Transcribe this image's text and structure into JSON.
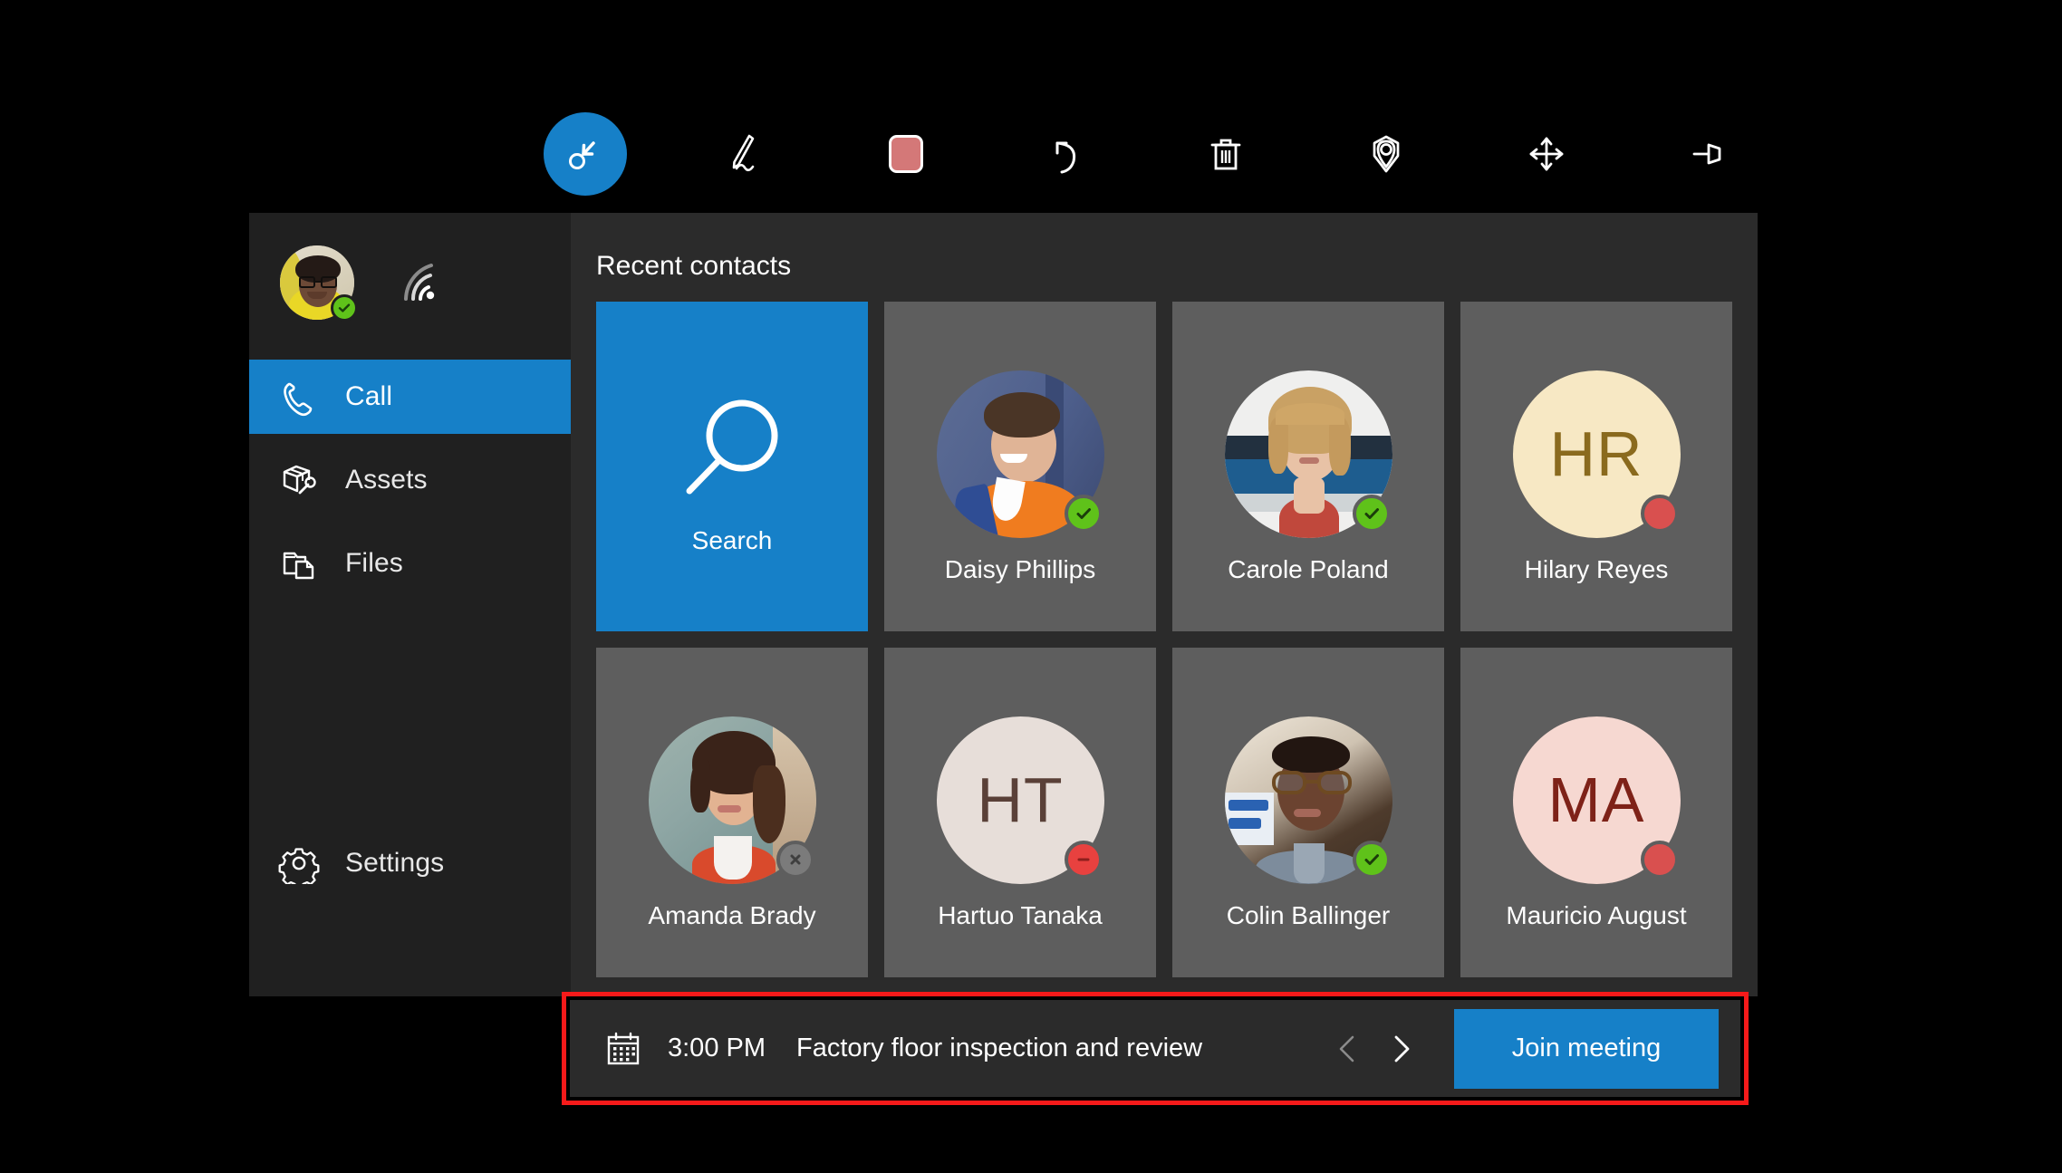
{
  "toolbar": {
    "tools": [
      {
        "name": "select-tool",
        "icon": "select-arrow-icon",
        "active": true
      },
      {
        "name": "ink-pen-tool",
        "icon": "pen-icon",
        "active": false
      },
      {
        "name": "color-swatch",
        "icon": "color-swatch-icon",
        "active": false,
        "color": "#d47878"
      },
      {
        "name": "undo-tool",
        "icon": "undo-arrow-icon",
        "active": false
      },
      {
        "name": "delete-tool",
        "icon": "trash-icon",
        "active": false
      },
      {
        "name": "place-hologram-tool",
        "icon": "location-pin-icon",
        "active": false
      },
      {
        "name": "move-tool",
        "icon": "move-arrows-icon",
        "active": false
      },
      {
        "name": "pin-tool",
        "icon": "pushpin-icon",
        "active": false
      }
    ]
  },
  "sidebar": {
    "profile": {
      "status": "available",
      "status_color": "#5fc21a",
      "signal_icon": "wifi-signal-icon"
    },
    "items": [
      {
        "label": "Call",
        "icon": "phone-icon",
        "selected": true
      },
      {
        "label": "Assets",
        "icon": "box-wrench-icon",
        "selected": false
      },
      {
        "label": "Files",
        "icon": "folder-document-icon",
        "selected": false
      },
      {
        "label": "Settings",
        "icon": "gear-icon",
        "selected": false
      }
    ]
  },
  "main": {
    "section_title": "Recent contacts",
    "search_tile": {
      "label": "Search",
      "icon": "magnifier-icon"
    },
    "contacts": [
      {
        "name": "Daisy Phillips",
        "type": "photo",
        "status": "available",
        "status_icon": "check-icon"
      },
      {
        "name": "Carole Poland",
        "type": "photo",
        "status": "available",
        "status_icon": "check-icon"
      },
      {
        "name": "Hilary Reyes",
        "type": "initials",
        "initials": "HR",
        "bg": "#f7e8c4",
        "fg": "#8a6a1e",
        "status": "busy",
        "status_icon": "none"
      },
      {
        "name": "Amanda Brady",
        "type": "photo",
        "status": "offline",
        "status_icon": "x-icon"
      },
      {
        "name": "Hartuo Tanaka",
        "type": "initials",
        "initials": "HT",
        "bg": "#e7ded9",
        "fg": "#5a4038",
        "status": "dnd",
        "status_icon": "minus-icon"
      },
      {
        "name": "Colin Ballinger",
        "type": "photo",
        "status": "available",
        "status_icon": "check-icon"
      },
      {
        "name": "Mauricio August",
        "type": "initials",
        "initials": "MA",
        "bg": "#f6d8d1",
        "fg": "#7e2218",
        "status": "busy",
        "status_icon": "none"
      }
    ]
  },
  "meeting": {
    "calendar_icon": "calendar-icon",
    "time": "3:00 PM",
    "title": "Factory floor inspection and review",
    "prev_label": "",
    "next_label": "",
    "join_label": "Join meeting",
    "highlight_color": "#f61a1a"
  },
  "colors": {
    "accent": "#1680c8",
    "window_bg": "#252525",
    "sidebar_bg": "#202020",
    "main_bg": "#2b2b2b",
    "tile_bg": "#5e5e5e",
    "available": "#5fc21a",
    "busy": "#d9504f",
    "dnd": "#e8413f",
    "offline": "#7b7b7b"
  }
}
